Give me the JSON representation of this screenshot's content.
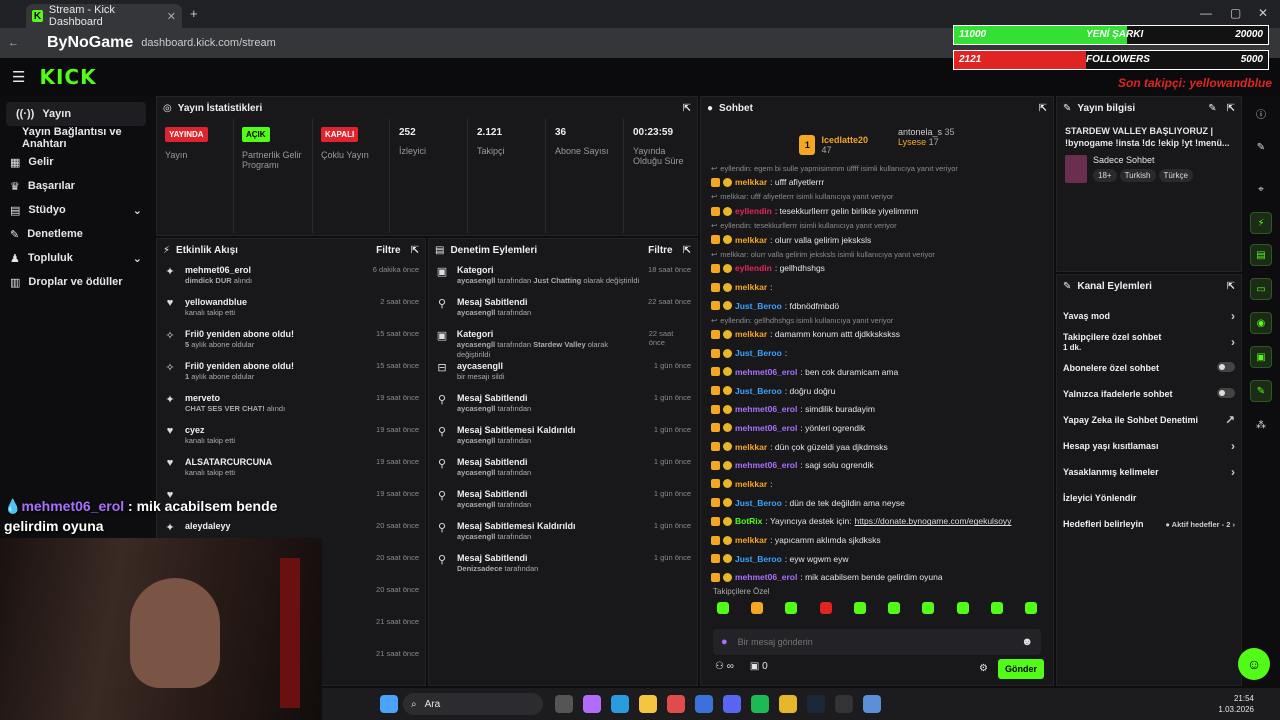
{
  "browser": {
    "tab_title": "Stream - Kick Dashboard",
    "url": "dashboard.kick.com/stream",
    "overlay_logo": "ByNoGame"
  },
  "overlay": {
    "bar1": {
      "left": "11000",
      "label": "YENİ ŞARKI",
      "right": "20000",
      "fraction": 0.55,
      "color": "#34e034"
    },
    "bar2": {
      "left": "2121",
      "label": "FOLLOWERS",
      "right": "5000",
      "fraction": 0.42,
      "color": "#e02424"
    },
    "last_follower": "Son takipçi: yellowandblue",
    "chat_bubble_user": "mehmet06_erol",
    "chat_bubble_text": "mik acabilsem bende gelirdim oyuna"
  },
  "header": {
    "logo": "KICK"
  },
  "sidebar": {
    "items": [
      {
        "label": "Yayın"
      },
      {
        "label": "Yayın Bağlantısı ve Anahtarı"
      },
      {
        "label": "Gelir"
      },
      {
        "label": "Başarılar"
      },
      {
        "label": "Stüdyo"
      },
      {
        "label": "Denetleme"
      },
      {
        "label": "Topluluk"
      },
      {
        "label": "Droplar ve ödüller"
      }
    ]
  },
  "stats": {
    "title": "Yayın İstatistikleri",
    "items": [
      {
        "badge": "YAYINDA",
        "label": "Yayın"
      },
      {
        "badge": "AÇIK",
        "label": "Partnerlik Gelir Programı"
      },
      {
        "badge": "KAPALI",
        "label": "Çoklu Yayın"
      },
      {
        "value": "252",
        "label": "İzleyici"
      },
      {
        "value": "2.121",
        "label": "Takipçi"
      },
      {
        "value": "36",
        "label": "Abone Sayısı"
      },
      {
        "value": "00:23:59",
        "label": "Yayında Olduğu Süre"
      }
    ]
  },
  "activity": {
    "title": "Etkinlik Akışı",
    "filter": "Filtre",
    "events": [
      {
        "name": "mehmet06_erol",
        "detail_hl": "dimdick DUR",
        "detail": " alındı",
        "time": "6 dakika önce"
      },
      {
        "name": "yellowandblue",
        "detail_hl": "",
        "detail": "kanalı takip etti",
        "time": "2 saat önce"
      },
      {
        "name": "Frii0 yeniden abone oldu!",
        "detail_hl": "5",
        "detail": " aylık abone oldular",
        "time": "15 saat önce"
      },
      {
        "name": "Frii0 yeniden abone oldu!",
        "detail_hl": "1",
        "detail": " aylık abone oldular",
        "time": "15 saat önce"
      },
      {
        "name": "merveto",
        "detail_hl": "CHAT SES VER CHAT!",
        "detail": " alındı",
        "time": "19 saat önce"
      },
      {
        "name": "cyez",
        "detail_hl": "",
        "detail": "kanalı takip etti",
        "time": "19 saat önce"
      },
      {
        "name": "ALSATARCURCUNA",
        "detail_hl": "",
        "detail": "kanalı takip etti",
        "time": "19 saat önce"
      },
      {
        "name": "",
        "detail_hl": "",
        "detail": "",
        "time": "19 saat önce"
      },
      {
        "name": "aleydaleyy",
        "detail_hl": "",
        "detail": "",
        "time": "20 saat önce"
      },
      {
        "name": "",
        "detail_hl": "",
        "detail": "",
        "time": "20 saat önce"
      },
      {
        "name": "",
        "detail_hl": "",
        "detail": "",
        "time": "20 saat önce"
      },
      {
        "name": "",
        "detail_hl": "",
        "detail": "",
        "time": "21 saat önce"
      },
      {
        "name": "",
        "detail_hl": "",
        "detail": "",
        "time": "21 saat önce"
      }
    ]
  },
  "moderation": {
    "title": "Denetim Eylemleri",
    "filter": "Filtre",
    "events": [
      {
        "icon": "▣",
        "name": "Kategori",
        "who": "aycasengll",
        "detail": " tarafından ",
        "hl2": "Just Chatting",
        "detail2": " olarak değiştirildi",
        "time": "18 saat önce"
      },
      {
        "icon": "⚲",
        "name": "Mesaj Sabitlendi",
        "who": "aycasengll",
        "detail": " tarafından",
        "hl2": "",
        "detail2": "",
        "time": "22 saat önce"
      },
      {
        "icon": "▣",
        "name": "Kategori",
        "who": "aycasengll",
        "detail": " tarafından ",
        "hl2": "Stardew Valley",
        "detail2": " olarak değiştirildi",
        "time": "22 saat önce"
      },
      {
        "icon": "⊟",
        "name": "aycasengll",
        "who": "",
        "detail": "bir mesajı sildi",
        "hl2": "",
        "detail2": "",
        "time": "1 gün önce"
      },
      {
        "icon": "⚲",
        "name": "Mesaj Sabitlendi",
        "who": "aycasengll",
        "detail": " tarafından",
        "hl2": "",
        "detail2": "",
        "time": "1 gün önce"
      },
      {
        "icon": "⚲",
        "name": "Mesaj Sabitlemesi Kaldırıldı",
        "who": "aycasengll",
        "detail": " tarafından",
        "hl2": "",
        "detail2": "",
        "time": "1 gün önce"
      },
      {
        "icon": "⚲",
        "name": "Mesaj Sabitlendi",
        "who": "aycasengll",
        "detail": " tarafından",
        "hl2": "",
        "detail2": "",
        "time": "1 gün önce"
      },
      {
        "icon": "⚲",
        "name": "Mesaj Sabitlendi",
        "who": "aycasengll",
        "detail": " tarafından",
        "hl2": "",
        "detail2": "",
        "time": "1 gün önce"
      },
      {
        "icon": "⚲",
        "name": "Mesaj Sabitlemesi Kaldırıldı",
        "who": "aycasengll",
        "detail": " tarafından",
        "hl2": "",
        "detail2": "",
        "time": "1 gün önce"
      },
      {
        "icon": "⚲",
        "name": "Mesaj Sabitlendi",
        "who": "Denizsadece",
        "detail": " tarafından",
        "hl2": "",
        "detail2": "",
        "time": "1 gün önce"
      }
    ]
  },
  "chat": {
    "title": "Sohbet",
    "top": [
      {
        "name": "Icedlatte20",
        "count": "47"
      },
      {
        "name": "antonela_s",
        "count": "35"
      },
      {
        "name": "Lysese",
        "count": "17"
      }
    ],
    "messages": [
      {
        "sys": "eyllendin: egem bi sulle yapmisimmm üffff isimli kullanıcıya yanıt veriyor"
      },
      {
        "user": "melkkar",
        "color": "#f5a623",
        "text": ": ufff afiyetlerrr"
      },
      {
        "sys": "melkkar: ufff afiyetlerrr isimli kullanıcıya yanıt veriyor"
      },
      {
        "user": "eyllendin",
        "color": "#e8245a",
        "text": ": tesekkurllerrr gelin birlikte yiyelimmm"
      },
      {
        "sys": "eyllendin: tesekkurllerrr isimli kullanıcıya yanıt veriyor"
      },
      {
        "user": "melkkar",
        "color": "#f5a623",
        "text": ": olurr valla gelirim jeksksls"
      },
      {
        "sys": "melkkar: olurr valla gelirim jeksksls isimli kullanıcıya yanıt veriyor"
      },
      {
        "user": "eyllendin",
        "color": "#e8245a",
        "text": ": gellhdhshgs"
      },
      {
        "user": "melkkar",
        "color": "#f5a623",
        "text": ":"
      },
      {
        "user": "Just_Beroo",
        "color": "#3ba3ff",
        "text": ": fdbnödfmbdö"
      },
      {
        "sys": "eyllendin: gellhdhshgs isimli kullanıcıya yanıt veriyor"
      },
      {
        "user": "melkkar",
        "color": "#f5a623",
        "text": ": damamm konum attt djdkkskskss"
      },
      {
        "user": "Just_Beroo",
        "color": "#3ba3ff",
        "text": ":"
      },
      {
        "user": "mehmet06_erol",
        "color": "#a970ff",
        "text": ": ben cok duramicam ama"
      },
      {
        "user": "Just_Beroo",
        "color": "#3ba3ff",
        "text": ": doğru doğru"
      },
      {
        "user": "mehmet06_erol",
        "color": "#a970ff",
        "text": ": simdilik buradayim"
      },
      {
        "user": "mehmet06_erol",
        "color": "#a970ff",
        "text": ": yönleri ogrendik"
      },
      {
        "user": "melkkar",
        "color": "#f5a623",
        "text": ": dün çok güzeldi yaa djkdmsks"
      },
      {
        "user": "mehmet06_erol",
        "color": "#a970ff",
        "text": ": sagi solu ogrendik"
      },
      {
        "user": "melkkar",
        "color": "#f5a623",
        "text": ":"
      },
      {
        "user": "Just_Beroo",
        "color": "#3ba3ff",
        "text": ": dün de tek değildin ama neyse"
      },
      {
        "user": "BotRix",
        "color": "#53fc18",
        "text": ": Yayıncıya destek için: ",
        "link": "https://donate.bynogame.com/egekulsoyy"
      },
      {
        "user": "melkkar",
        "color": "#f5a623",
        "text": ": yapıcamm aklımda sjkdksks"
      },
      {
        "user": "Just_Beroo",
        "color": "#3ba3ff",
        "text": ": eyw wgwm eyw"
      },
      {
        "user": "mehmet06_erol",
        "color": "#a970ff",
        "text": ": mik acabilsem bende gelirdim oyuna"
      }
    ],
    "followers_only": "Takipçilere Özel",
    "input_placeholder": "Bir mesaj gönderin",
    "infinity": "∞",
    "count": "0",
    "send": "Gönder"
  },
  "stream_info": {
    "title": "Yayın bilgisi",
    "stream_title": "STARDEW VALLEY BAŞLIYORUZ | !bynogame !insta !dc !ekip !yt !menü...",
    "category": "Sadece Sohbet",
    "tags": [
      "18+",
      "Turkish",
      "Türkçe"
    ]
  },
  "channel_actions": {
    "title": "Kanal Eylemleri",
    "items": [
      {
        "label": "Yavaş mod",
        "sub": "",
        "right": "›"
      },
      {
        "label": "Takipçilere özel sohbet",
        "sub": "1 dk.",
        "right": "›"
      },
      {
        "label": "Abonelere özel sohbet",
        "sub": "",
        "right": "toggle"
      },
      {
        "label": "Yalnızca ifadelerle sohbet",
        "sub": "",
        "right": "toggle"
      },
      {
        "label": "Yapay Zeka ile Sohbet Denetimi",
        "sub": "",
        "right": "↗"
      },
      {
        "label": "Hesap yaşı kısıtlaması",
        "sub": "",
        "right": "›"
      },
      {
        "label": "Yasaklanmış kelimeler",
        "sub": "",
        "right": "›"
      },
      {
        "label": "İzleyici Yönlendir",
        "sub": "",
        "right": ""
      },
      {
        "label": "Hedefleri belirleyin",
        "sub": "",
        "right": "● Aktif hedefler - 2 ›"
      }
    ]
  },
  "taskbar": {
    "search": "Ara",
    "time": "21:54",
    "date": "1.03.2026"
  }
}
